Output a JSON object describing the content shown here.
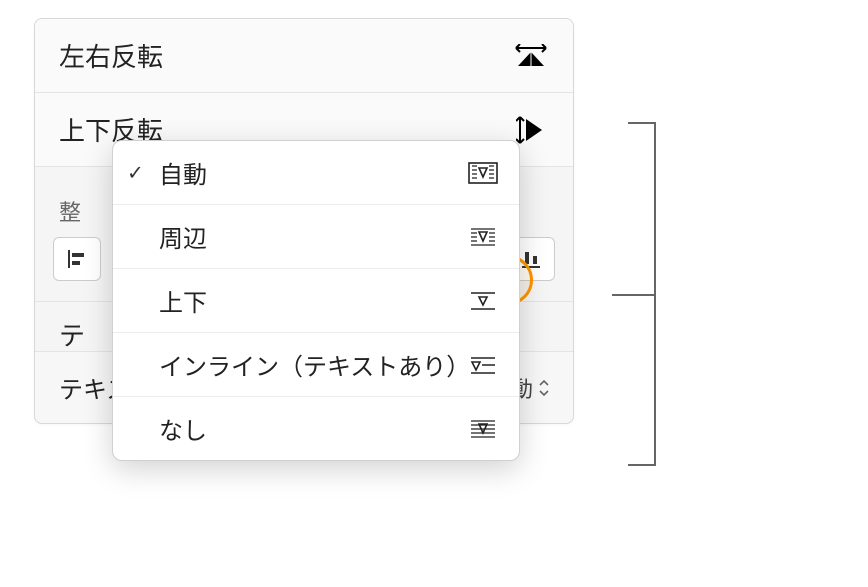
{
  "panel": {
    "flip_h_label": "左右反転",
    "flip_v_label": "上下反転",
    "align_label": "整",
    "text_label": "テ"
  },
  "wrap": {
    "label": "テキスト折り返し",
    "value": "自動"
  },
  "popover": {
    "items": [
      {
        "label": "自動",
        "checked": true
      },
      {
        "label": "周辺",
        "checked": false
      },
      {
        "label": "上下",
        "checked": false
      },
      {
        "label": "インライン（テキストあり）",
        "checked": false
      },
      {
        "label": "なし",
        "checked": false
      }
    ]
  }
}
